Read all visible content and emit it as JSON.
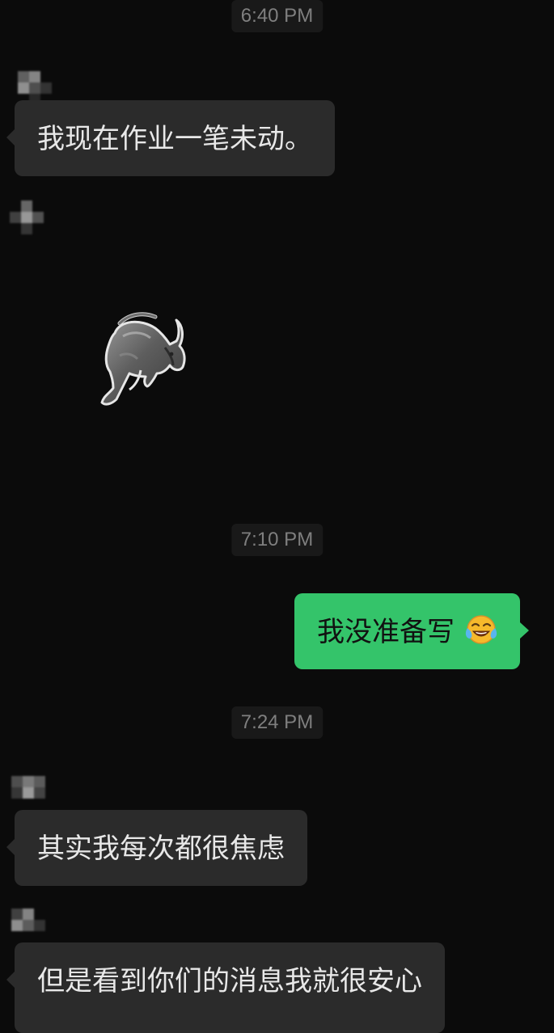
{
  "timestamps": [
    "6:40 PM",
    "7:10 PM",
    "7:24 PM"
  ],
  "messages": {
    "m1": "我现在作业一笔未动。",
    "m3": "我没准备写",
    "m4": "其实我每次都很焦虑",
    "m5": "但是看到你们的消息我就很安心"
  },
  "icons": {
    "sticker": "bull-statue-sticker",
    "emoji": "face-with-tears-of-joy-emoji",
    "avatar": "pixelated-avatar"
  },
  "colors": {
    "background": "#0b0b0b",
    "incoming_bubble": "#2b2b2b",
    "outgoing_bubble": "#34c46a",
    "timestamp_text": "#7f7f7f"
  }
}
